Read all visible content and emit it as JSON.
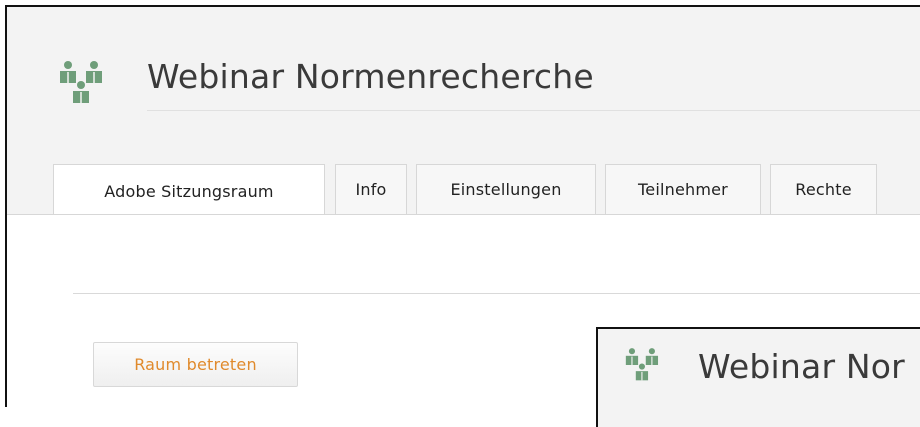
{
  "header": {
    "title": "Webinar Normenrecherche",
    "icon": "group-users-icon"
  },
  "tabs": [
    {
      "label": "Adobe Sitzungsraum",
      "active": true
    },
    {
      "label": "Info",
      "active": false
    },
    {
      "label": "Einstellungen",
      "active": false
    },
    {
      "label": "Teilnehmer",
      "active": false
    },
    {
      "label": "Rechte",
      "active": false
    }
  ],
  "main": {
    "enter_button_label": "Raum betreten"
  },
  "inset": {
    "title": "Webinar Nor",
    "icon": "group-users-icon"
  },
  "colors": {
    "icon_green": "#6f9e7a",
    "button_text_orange": "#e08a2c",
    "header_background": "#f3f3f3",
    "title_text": "#3a3a3a"
  }
}
